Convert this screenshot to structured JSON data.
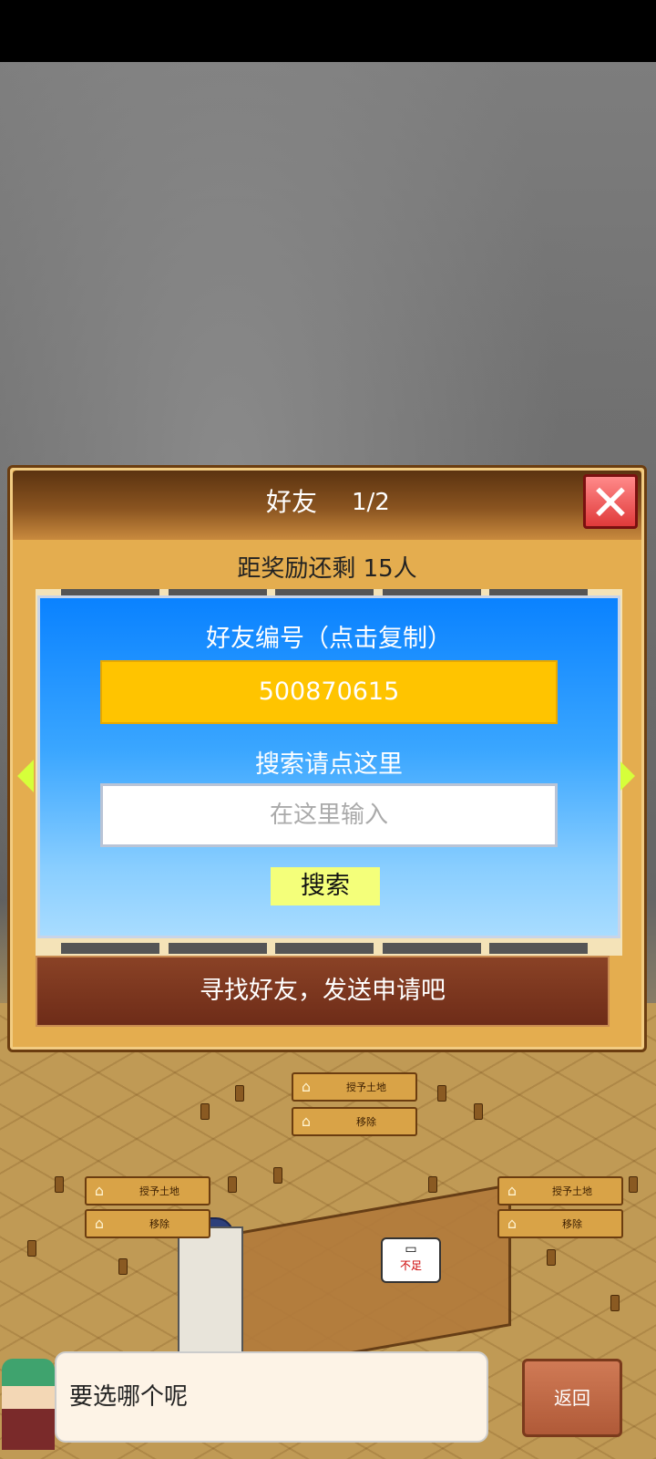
{
  "dialog": {
    "title": "好友",
    "page": "1/2",
    "remaining_text": "距奖励还剩 15人",
    "friend_id_label": "好友编号（点击复制）",
    "friend_id": "500870615",
    "search_label": "搜索请点这里",
    "search_placeholder": "在这里输入",
    "search_button": "搜索",
    "find_banner": "寻找好友，发送申请吧"
  },
  "map_signs": {
    "grant_land": "授予土地",
    "remove": "移除"
  },
  "bubble_text": "不足",
  "message": {
    "text": "要选哪个呢",
    "back_button": "返回"
  },
  "icons": {
    "close": "close-icon",
    "left_arrow": "arrow-left-icon",
    "right_arrow": "arrow-right-icon",
    "house": "house-icon"
  }
}
